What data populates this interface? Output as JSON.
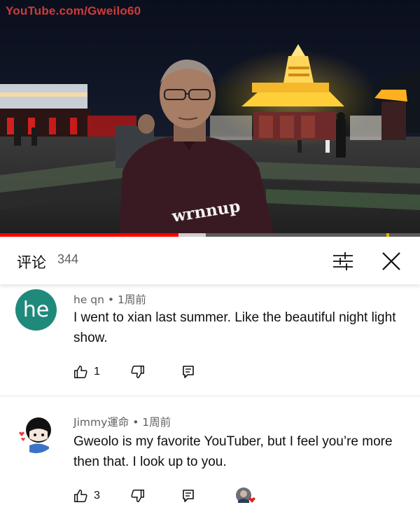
{
  "video": {
    "watermark": "YouTube.com/Gweilo60",
    "shirt_text": "wrnnup",
    "progress_played": 0.425,
    "progress_buffered_to": 0.49
  },
  "header": {
    "title": "评论",
    "count": "344",
    "filter_icon": "sort-sliders-icon",
    "close_icon": "close-icon"
  },
  "comments": [
    {
      "avatar_text": "he",
      "author": "he qn",
      "time": "1周前",
      "text": "I went to xian last summer. Like the beautiful night light show.",
      "likes": "1"
    },
    {
      "avatar_text": "",
      "author": "Jimmy運命",
      "time": "1周前",
      "text": "Gweolo is my favorite YouTuber, but I feel you’re more then that. I look up to you.",
      "likes": "3"
    }
  ],
  "colors": {
    "accent_red": "#ff0000",
    "avatar_teal": "#1f8a7c",
    "text_primary": "#0f0f0f",
    "text_secondary": "#606060"
  }
}
